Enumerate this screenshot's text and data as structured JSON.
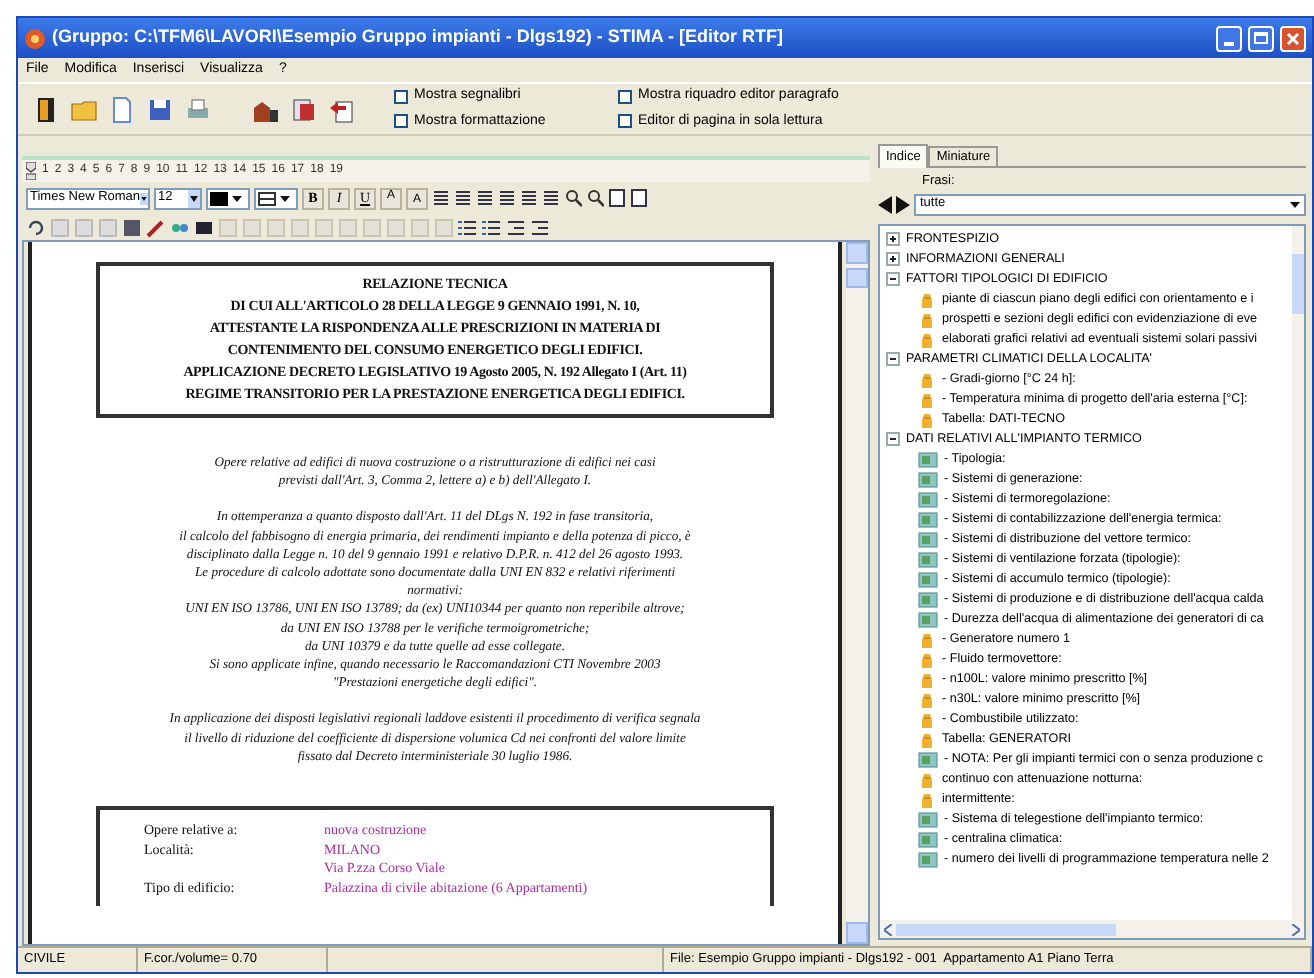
{
  "window": {
    "title": "(Gruppo: C:\\TFM6\\LAVORI\\Esempio Gruppo impianti - Dlgs192) - STIMA - [Editor RTF]"
  },
  "menu": [
    "File",
    "Modifica",
    "Inserisci",
    "Visualizza",
    "?"
  ],
  "options": [
    {
      "label": "Mostra segnalibri",
      "checked": false
    },
    {
      "label": "Mostra formattazione",
      "checked": false
    },
    {
      "label": "Mostra riquadro editor paragrafo",
      "checked": false
    },
    {
      "label": "Editor di pagina in sola lettura",
      "checked": false
    }
  ],
  "ruler": [
    "1",
    "2",
    "3",
    "4",
    "5",
    "6",
    "7",
    "8",
    "9",
    "10",
    "11",
    "12",
    "13",
    "14",
    "15",
    "16",
    "17",
    "18",
    "19"
  ],
  "format_toolbar": {
    "font": "Times New Roman",
    "size": "12",
    "style_buttons": [
      "B",
      "I",
      "U"
    ],
    "script_buttons": [
      "A",
      "A"
    ]
  },
  "document": {
    "heading": [
      "RELAZIONE TECNICA",
      "DI CUI ALL'ARTICOLO 28 DELLA LEGGE 9 GENNAIO 1991, N. 10,",
      "ATTESTANTE LA RISPONDENZA ALLE PRESCRIZIONI IN MATERIA DI",
      "CONTENIMENTO DEL CONSUMO ENERGETICO DEGLI EDIFICI.",
      "APPLICAZIONE DECRETO LEGISLATIVO 19 Agosto 2005, N. 192 Allegato I (Art. 11)",
      "REGIME TRANSITORIO PER LA PRESTAZIONE ENERGETICA DEGLI EDIFICI."
    ],
    "paragraphs": [
      "Opere relative ad edifici di nuova costruzione o a ristrutturazione di edifici nei casi\nprevisti dall'Art. 3, Comma 2, lettere a) e b) dell'Allegato I.",
      "In ottemperanza a quanto disposto dall'Art. 11 del DLgs N. 192 in fase transitoria,\nil calcolo del fabbisogno di energia primaria, dei rendimenti impianto e della potenza di picco, è\ndisciplinato dalla Legge n. 10 del 9 gennaio 1991 e relativo D.P.R. n. 412 del 26 agosto 1993.\nLe procedure di calcolo adottate sono documentate dalla UNI EN 832 e relativi riferimenti\nnormativi:\nUNI EN ISO 13786, UNI EN ISO 13789; da (ex) UNI10344 per quanto non reperibile altrove;\nda UNI EN ISO 13788 per le verifiche termoigrometriche;\nda UNI 10379 e da tutte quelle ad esse collegate.\nSi sono applicate infine, quando necessario le Raccomandazioni CTI Novembre 2003\n\"Prestazioni energetiche degli edifici\".",
      "In applicazione dei disposti legislativi regionali laddove esistenti il procedimento di verifica segnala\nil livello di riduzione del coefficiente di dispersione volumica Cd nei confronti del valore limite\nfissato dal Decreto interministeriale 30 luglio 1986."
    ],
    "info_rows": [
      {
        "label": "Opere relative a:",
        "value": "nuova costruzione"
      },
      {
        "label": "Località:",
        "value": "MILANO"
      },
      {
        "value": "Via P.zza Corso Viale"
      },
      {
        "label": "Tipo di edificio:",
        "value": "Palazzina di civile abitazione (6 Appartamenti)"
      }
    ]
  },
  "side_tabs": [
    {
      "label": "Indice",
      "selected": true
    },
    {
      "label": "Miniature",
      "selected": false
    }
  ],
  "phrases": {
    "label": "Frasi:",
    "value": "tutte"
  },
  "tree": [
    {
      "label": "FRONTESPIZIO",
      "expanded": false
    },
    {
      "label": "INFORMAZIONI GENERALI",
      "expanded": false
    },
    {
      "label": "FATTORI TIPOLOGICI DI EDIFICIO",
      "expanded": true,
      "children": [
        {
          "label": "piante di ciascun piano degli edifici con orientamento e i",
          "kind": "note"
        },
        {
          "label": "prospetti e sezioni degli edifici con evidenziazione di eve",
          "kind": "note"
        },
        {
          "label": "elaborati grafici relativi ad eventuali sistemi solari passivi",
          "kind": "note"
        }
      ]
    },
    {
      "label": "PARAMETRI CLIMATICI DELLA LOCALITA'",
      "expanded": true,
      "children": [
        {
          "label": "- Gradi-giorno [°C 24 h]:",
          "kind": "note"
        },
        {
          "label": "- Temperatura minima di progetto dell'aria esterna [°C]:",
          "kind": "note"
        },
        {
          "label": "Tabella: DATI-TECNO",
          "kind": "note"
        }
      ]
    },
    {
      "label": "DATI RELATIVI ALL'IMPIANTO TERMICO",
      "expanded": true,
      "children": [
        {
          "label": "- Tipologia:",
          "kind": "field"
        },
        {
          "label": "- Sistemi di generazione:",
          "kind": "field"
        },
        {
          "label": "- Sistemi di termoregolazione:",
          "kind": "field"
        },
        {
          "label": "- Sistemi di contabilizzazione dell'energia termica:",
          "kind": "field"
        },
        {
          "label": "- Sistemi di distribuzione del vettore termico:",
          "kind": "field"
        },
        {
          "label": "- Sistemi di ventilazione forzata (tipologie):",
          "kind": "field"
        },
        {
          "label": "- Sistemi di accumulo termico (tipologie):",
          "kind": "field"
        },
        {
          "label": "- Sistemi di produzione e di distribuzione dell'acqua calda",
          "kind": "field"
        },
        {
          "label": "- Durezza dell'acqua di alimentazione dei generatori di ca",
          "kind": "field"
        },
        {
          "label": "- Generatore numero 1",
          "kind": "note"
        },
        {
          "label": "- Fluido termovettore:",
          "kind": "note"
        },
        {
          "label": "- n100L: valore minimo prescritto [%]",
          "kind": "note"
        },
        {
          "label": "- n30L: valore minimo prescritto [%]",
          "kind": "note"
        },
        {
          "label": "- Combustibile utilizzato:",
          "kind": "note"
        },
        {
          "label": "Tabella: GENERATORI",
          "kind": "note"
        },
        {
          "label": "- NOTA: Per gli impianti termici con o senza produzione c",
          "kind": "field"
        },
        {
          "label": "continuo con attenuazione notturna:",
          "kind": "note"
        },
        {
          "label": "intermittente:",
          "kind": "note"
        },
        {
          "label": "- Sistema di telegestione dell'impianto termico:",
          "kind": "field"
        },
        {
          "label": "- centralina climatica:",
          "kind": "field"
        },
        {
          "label": "- numero dei livelli di programmazione temperatura nelle 2",
          "kind": "field"
        }
      ]
    }
  ],
  "status_bar": [
    "CIVILE",
    "F.cor./volume= 0.70",
    "File: Esempio Gruppo impianti - Dlgs192 - 001  Appartamento A1 Piano Terra"
  ]
}
